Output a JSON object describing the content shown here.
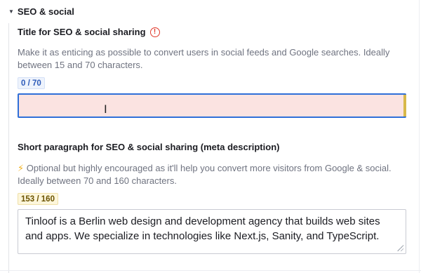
{
  "section": {
    "caret_icon": "caret-down-icon",
    "title": "SEO & social"
  },
  "seo_title": {
    "label": "Title for SEO & social sharing",
    "warning_icon": "warning-circle-icon",
    "warning_glyph": "!",
    "description": "Make it as enticing as possible to convert users in social feeds and Google searches. Ideally between 15 and 70 characters.",
    "counter": "0 / 70",
    "value": "",
    "cursor_glyph": "I"
  },
  "seo_description": {
    "label": "Short paragraph for SEO & social sharing (meta description)",
    "bolt_glyph": "⚡",
    "description": "Optional but highly encouraged as it'll help you convert more visitors from Google & social. Ideally between 70 and 160 characters.",
    "counter": "153 / 160",
    "value": "Tinloof is a Berlin web design and development agency that builds web sites and apps. We specialize in technologies like Next.js, Sanity, and TypeScript."
  },
  "colors": {
    "error_fill": "#fbe3e1",
    "focus_border": "#2f6fd8",
    "warning": "#e0392b",
    "counter_ok": "#2d5bb9",
    "counter_warn": "#6b5300"
  }
}
